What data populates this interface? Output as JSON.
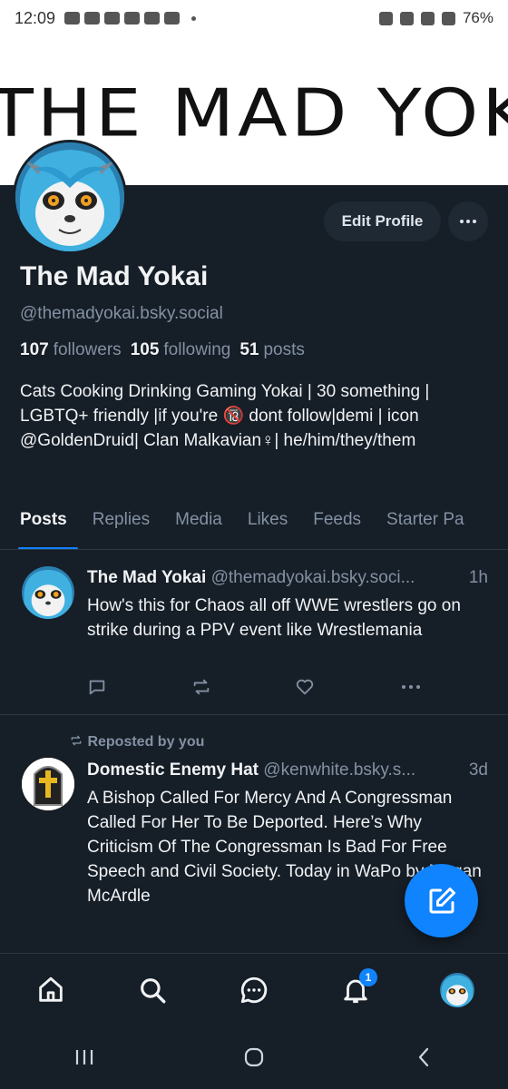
{
  "status_bar": {
    "time": "12:09",
    "battery": "76%"
  },
  "banner": {
    "text": "THE MAD YOKAI"
  },
  "profile": {
    "edit_label": "Edit Profile",
    "display_name": "The Mad Yokai",
    "handle": "@themadyokai.bsky.social",
    "followers_count": "107",
    "followers_label": "followers",
    "following_count": "105",
    "following_label": "following",
    "posts_count": "51",
    "posts_label": "posts",
    "bio": "Cats Cooking Drinking Gaming Yokai | 30 something | LGBTQ+ friendly |if you're 🔞 dont follow|demi | icon @GoldenDruid| Clan Malkavian♀| he/him/they/them"
  },
  "tabs": [
    "Posts",
    "Replies",
    "Media",
    "Likes",
    "Feeds",
    "Starter Pa"
  ],
  "posts": [
    {
      "author": "The Mad Yokai",
      "handle": "@themadyokai.bsky.soci...",
      "age": "1h",
      "text": "How's this for Chaos all off WWE wrestlers go on strike during a PPV event like Wrestlemania"
    },
    {
      "repost_label": "Reposted by you",
      "author": "Domestic Enemy Hat",
      "handle": "@kenwhite.bsky.s...",
      "age": "3d",
      "text": "A Bishop Called For Mercy And A Congressman Called For Her To Be Deported.  Here’s Why Criticism Of The Congressman Is Bad For Free Speech and Civil Society.  Today in WaPo by Megan McArdle"
    }
  ],
  "nav": {
    "notification_count": "1"
  },
  "colors": {
    "background": "#161e27",
    "accent": "#1083fe",
    "muted": "#8391a3"
  }
}
